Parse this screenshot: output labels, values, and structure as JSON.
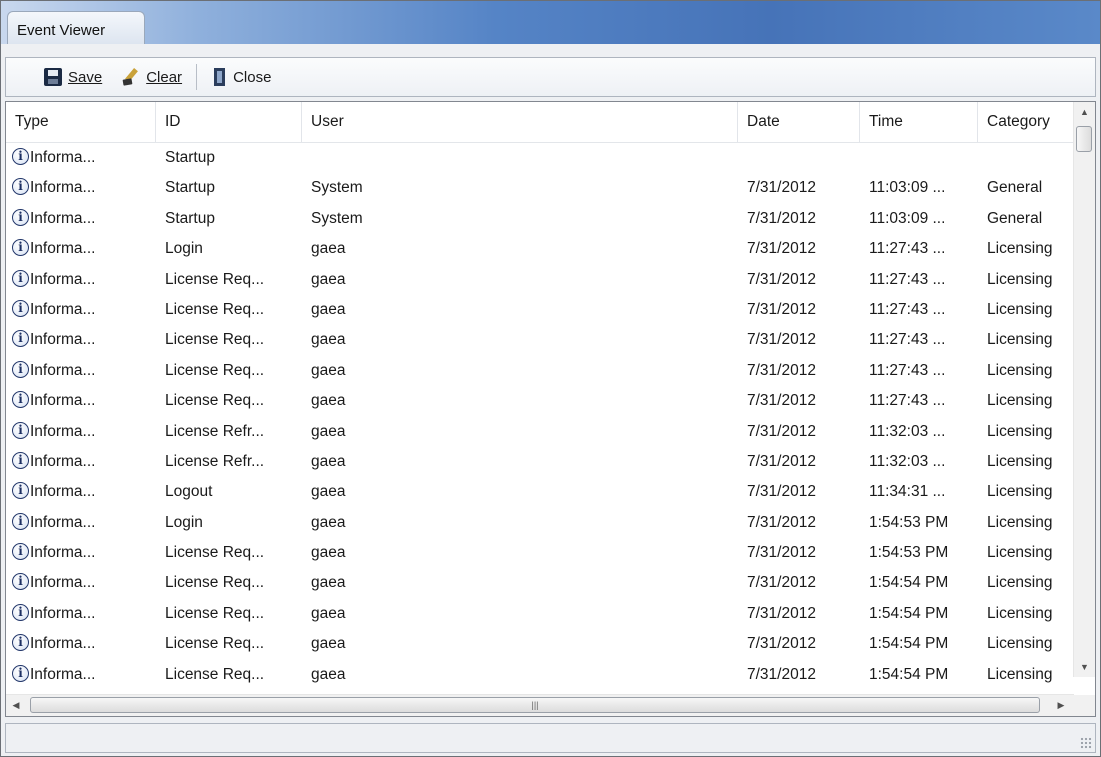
{
  "window": {
    "title": "Event Viewer"
  },
  "toolbar": {
    "save_label": "Save",
    "clear_label": "Clear",
    "close_label": "Close"
  },
  "columns": [
    "Type",
    "ID",
    "User",
    "Date",
    "Time",
    "Category"
  ],
  "rows": [
    [
      "Informa...",
      "Startup",
      "",
      "",
      "",
      ""
    ],
    [
      "Informa...",
      "Startup",
      "System",
      "7/31/2012",
      "11:03:09 ...",
      "General"
    ],
    [
      "Informa...",
      "Startup",
      "System",
      "7/31/2012",
      "11:03:09 ...",
      "General"
    ],
    [
      "Informa...",
      "Login",
      "gaea",
      "7/31/2012",
      "11:27:43 ...",
      "Licensing"
    ],
    [
      "Informa...",
      "License Req...",
      "gaea",
      "7/31/2012",
      "11:27:43 ...",
      "Licensing"
    ],
    [
      "Informa...",
      "License Req...",
      "gaea",
      "7/31/2012",
      "11:27:43 ...",
      "Licensing"
    ],
    [
      "Informa...",
      "License Req...",
      "gaea",
      "7/31/2012",
      "11:27:43 ...",
      "Licensing"
    ],
    [
      "Informa...",
      "License Req...",
      "gaea",
      "7/31/2012",
      "11:27:43 ...",
      "Licensing"
    ],
    [
      "Informa...",
      "License Req...",
      "gaea",
      "7/31/2012",
      "11:27:43 ...",
      "Licensing"
    ],
    [
      "Informa...",
      "License Refr...",
      "gaea",
      "7/31/2012",
      "11:32:03 ...",
      "Licensing"
    ],
    [
      "Informa...",
      "License Refr...",
      "gaea",
      "7/31/2012",
      "11:32:03 ...",
      "Licensing"
    ],
    [
      "Informa...",
      "Logout",
      "gaea",
      "7/31/2012",
      "11:34:31 ...",
      "Licensing"
    ],
    [
      "Informa...",
      "Login",
      "gaea",
      "7/31/2012",
      "1:54:53 PM",
      "Licensing"
    ],
    [
      "Informa...",
      "License Req...",
      "gaea",
      "7/31/2012",
      "1:54:53 PM",
      "Licensing"
    ],
    [
      "Informa...",
      "License Req...",
      "gaea",
      "7/31/2012",
      "1:54:54 PM",
      "Licensing"
    ],
    [
      "Informa...",
      "License Req...",
      "gaea",
      "7/31/2012",
      "1:54:54 PM",
      "Licensing"
    ],
    [
      "Informa...",
      "License Req...",
      "gaea",
      "7/31/2012",
      "1:54:54 PM",
      "Licensing"
    ],
    [
      "Informa...",
      "License Req...",
      "gaea",
      "7/31/2012",
      "1:54:54 PM",
      "Licensing"
    ]
  ],
  "icons": {
    "row_type_icon": "information-icon",
    "save": "floppy-disk-icon",
    "clear": "brush-icon",
    "close": "door-icon"
  },
  "colors": {
    "titlebar_accent": "#4673b8",
    "info_icon": "#23376a"
  },
  "statusbar": {
    "text": ""
  }
}
